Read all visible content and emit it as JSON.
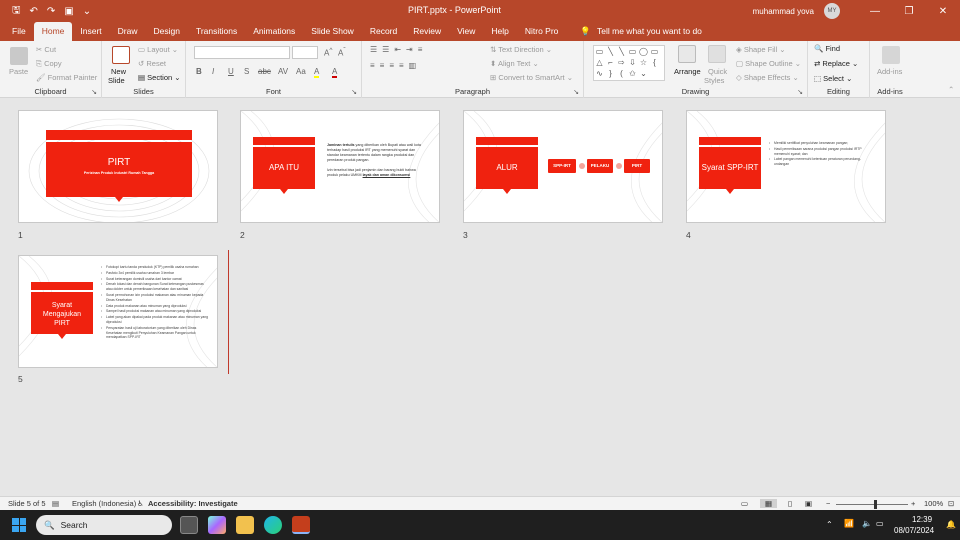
{
  "window": {
    "title": "PIRT.pptx  -  PowerPoint",
    "user": "muhammad yova",
    "avatar_initials": "MY",
    "qat": [
      "save-icon",
      "undo-icon",
      "redo-icon",
      "start-from-beginning-icon",
      "customize-icon"
    ],
    "controls": {
      "minimize": "—",
      "restore": "❐",
      "close": "✕"
    }
  },
  "tabs": [
    "File",
    "Home",
    "Insert",
    "Draw",
    "Design",
    "Transitions",
    "Animations",
    "Slide Show",
    "Record",
    "Review",
    "View",
    "Help",
    "Nitro Pro"
  ],
  "active_tab": "Home",
  "tell_me": "Tell me what you want to do",
  "ribbon": {
    "clipboard": {
      "label": "Clipboard",
      "paste": "Paste",
      "cut": "Cut",
      "copy": "Copy",
      "format_painter": "Format Painter"
    },
    "slides": {
      "label": "Slides",
      "new_slide": "New",
      "new_slide2": "Slide",
      "layout": "Layout",
      "reset": "Reset",
      "section": "Section"
    },
    "font": {
      "label": "Font",
      "buttons": [
        "B",
        "I",
        "U",
        "S",
        "abc",
        "AV",
        "Aa",
        "A",
        "A"
      ]
    },
    "paragraph": {
      "label": "Paragraph",
      "text_direction": "Text Direction",
      "align_text": "Align Text",
      "convert_smartart": "Convert to SmartArt"
    },
    "drawing": {
      "label": "Drawing",
      "arrange": "Arrange",
      "quick_styles": "Quick",
      "quick_styles2": "Styles",
      "shape_fill": "Shape Fill",
      "shape_outline": "Shape Outline",
      "shape_effects": "Shape Effects"
    },
    "editing": {
      "label": "Editing",
      "find": "Find",
      "replace": "Replace",
      "select": "Select"
    },
    "addins": {
      "label": "Add-ins",
      "addins": "Add-ins"
    }
  },
  "slides": [
    {
      "number": "1",
      "title": "PIRT",
      "subtitle": "Perizinan Produk Industri Rumah Tangga"
    },
    {
      "number": "2",
      "title": "APA ITU",
      "para1_lead": "Jaminan tertulis",
      "para1": " yang diberikan oleh Bupati atau wali kota terhadap hasil produksi IRT yang memenuhi syarat dan standar keamanan tertentu dalam rangka produksi dan peredaran produk pangan.",
      "para2": "Izin tersebut bisa jadi penjamin dan barang bukti bahwa produk pelaku UMKM ",
      "para2_link": "layak dan aman dikonsumsi"
    },
    {
      "number": "3",
      "title": "ALUR",
      "steps": [
        "SPP-IRT",
        "PELAKU",
        "PIRT"
      ]
    },
    {
      "number": "4",
      "title": "Syarat SPP-IRT",
      "bullets": [
        "Memiliki sertifikat penyuluhan keamanan pangan;",
        "Hasil pemeriksaan sarana produksi pangan produksi IRTP memenuhi syarat; dan",
        "Label pangan memenuhi ketentuan peraturan perundang-undangan"
      ]
    },
    {
      "number": "5",
      "title": "Syarat Mengajukan PIRT",
      "bullets": [
        "Fotokopi kartu tanda penduduk (KTP) pemilik usaha rumahan",
        "Pasfoto 3x4 pemilik usaha rumahan 3 lembar",
        "Surat keterangan domisili usaha dari kantor camat",
        "Denah lokasi dan denah bangunan Surat keterangan puskesmas atau dokter untuk pemeriksaan kesehatan dan sanitasi",
        "Surat permohonan izin produksi makanan atau minuman kepada Dinas Kesehatan",
        "Data produk makanan atau minuman yang diproduksi",
        "Sampel hasil produksi makanan atau minuman yang diproduksi",
        "Label yang akan dipakai pada produk makanan atau minuman yang diproduksi",
        "Persyaratan hasil uji laboratorium yang diberikan oleh Dinas Kesehatan mengikuti Penyuluhan Keamanan Pangan untuk mendapatkan SPP-IRT"
      ]
    }
  ],
  "status": {
    "slide_pos": "Slide 5 of 5",
    "language": "English (Indonesia)",
    "accessibility": "Accessibility: Investigate",
    "zoom": "100%",
    "zoom_percent": 50
  },
  "taskbar": {
    "search": "Search",
    "time": "12:39",
    "date": "08/07/2024"
  },
  "colors": {
    "accent": "#b7472a",
    "slide_red": "#f0220f"
  }
}
